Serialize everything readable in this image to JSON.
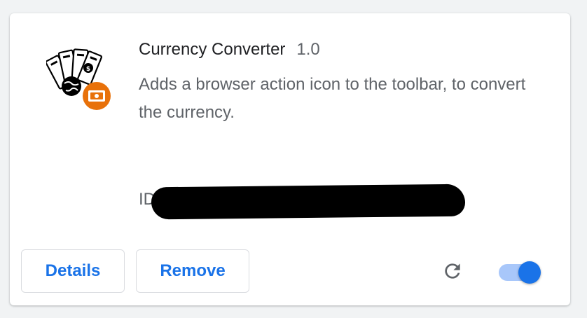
{
  "extension": {
    "name": "Currency Converter",
    "version": "1.0",
    "description": "Adds a browser action icon to the toolbar, to convert the currency.",
    "id_label": "ID",
    "icon": "money-globe-icon",
    "badge_icon": "unpacked-extension-badge-icon"
  },
  "actions": {
    "details_label": "Details",
    "remove_label": "Remove",
    "reload_icon": "reload-icon",
    "enabled": true
  },
  "colors": {
    "accent": "#1a73e8",
    "badge": "#e8710a",
    "toggle_track": "#a8c7fa",
    "text_primary": "#202124",
    "text_secondary": "#5f6368"
  }
}
